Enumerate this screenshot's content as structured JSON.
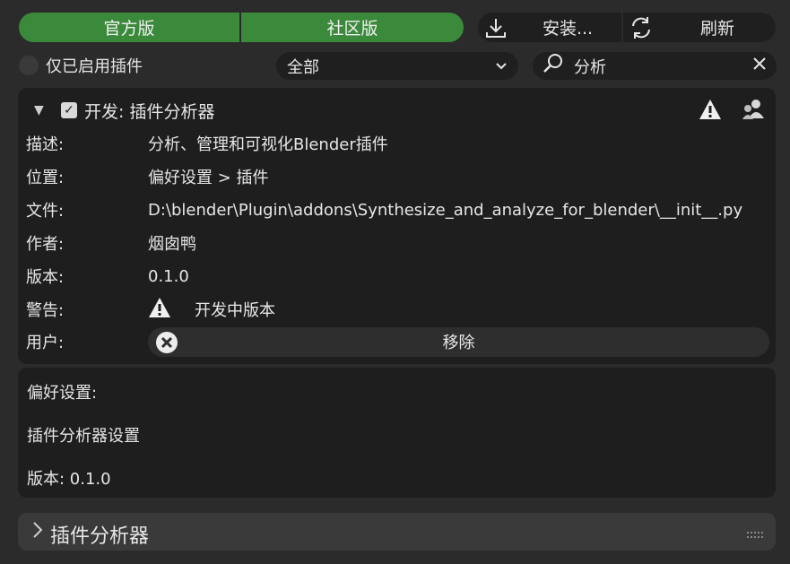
{
  "toolbar": {
    "official_label": "官方版",
    "community_label": "社区版",
    "install_label": "安装...",
    "refresh_label": "刷新"
  },
  "filters": {
    "enabled_only_label": "仅已启用插件",
    "category_value": "全部",
    "search_value": "分析"
  },
  "addon": {
    "title": "开发: 插件分析器",
    "rows": [
      {
        "key": "描述:",
        "value": "分析、管理和可视化Blender插件"
      },
      {
        "key": "位置:",
        "value": "偏好设置 > 插件"
      },
      {
        "key": "文件:",
        "value": "D:\\blender\\Plugin\\addons\\Synthesize_and_analyze_for_blender\\__init__.py"
      },
      {
        "key": "作者:",
        "value": "烟囱鸭"
      },
      {
        "key": "版本:",
        "value": "0.1.0"
      },
      {
        "key": "警告:",
        "value": "开发中版本"
      },
      {
        "key": "用户:",
        "value": ""
      }
    ],
    "remove_label": "移除"
  },
  "preferences": {
    "heading": "偏好设置:",
    "settings_label": "插件分析器设置",
    "version_label": "版本: 0.1.0"
  },
  "collapsed_panel": {
    "title": "插件分析器"
  },
  "colors": {
    "accent_green": "#3b8a3b",
    "background": "#2b2b2b",
    "panel": "#1e1e1e"
  }
}
